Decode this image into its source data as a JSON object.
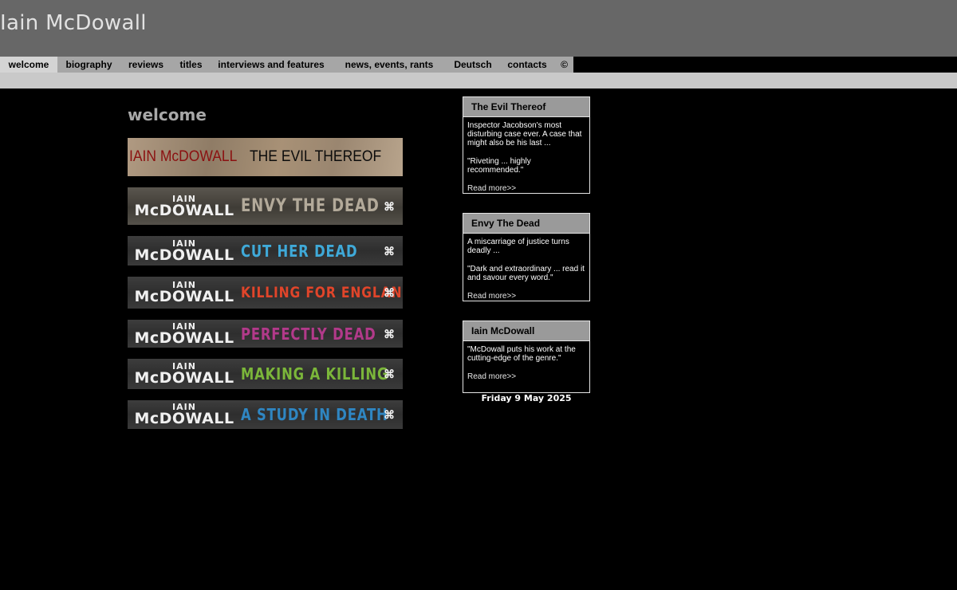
{
  "site": {
    "title": "Iain McDowall"
  },
  "nav": {
    "items": [
      {
        "label": "welcome",
        "active": true
      },
      {
        "label": "biography"
      },
      {
        "label": "reviews"
      },
      {
        "label": "titles"
      },
      {
        "label": "interviews and features"
      },
      {
        "label": "news, events, rants"
      },
      {
        "label": "Deutsch"
      },
      {
        "label": "contacts"
      },
      {
        "label": "©"
      }
    ]
  },
  "main": {
    "heading": "welcome",
    "banners": [
      {
        "author": "IAIN McDOWALL",
        "title": "THE EVIL THEREOF",
        "title_color": "#0c0c0c",
        "author_color": "#8b1010"
      },
      {
        "author_top": "IAIN",
        "author_bottom": "McDOWALL",
        "title": "ENVY THE DEAD",
        "title_color": "#b3aa9a"
      },
      {
        "author_top": "IAIN",
        "author_bottom": "McDOWALL",
        "title": "CUT HER DEAD",
        "title_color": "#3fa9d8"
      },
      {
        "author_top": "IAIN",
        "author_bottom": "McDOWALL",
        "title": "KILLING FOR ENGLAND",
        "title_color": "#e0452a"
      },
      {
        "author_top": "IAIN",
        "author_bottom": "McDOWALL",
        "title": "PERFECTLY DEAD",
        "title_color": "#b23a8a"
      },
      {
        "author_top": "IAIN",
        "author_bottom": "McDOWALL",
        "title": "MAKING A KILLING",
        "title_color": "#7bb63a"
      },
      {
        "author_top": "IAIN",
        "author_bottom": "McDOWALL",
        "title": "A STUDY IN DEATH",
        "title_color": "#2f86c2"
      }
    ]
  },
  "sidebar": {
    "boxes": [
      {
        "title": "The Evil Thereof",
        "paragraphs": [
          "Inspector Jacobson's most disturbing case ever. A case that might also be his last ...",
          "\"Riveting ... highly recommended.\""
        ],
        "link": "Read more>>"
      },
      {
        "title": "Envy The Dead",
        "paragraphs": [
          "A miscarriage of justice turns deadly ...",
          "\"Dark and extraordinary ... read it and savour every word.\""
        ],
        "link": "Read more>>"
      },
      {
        "title": "Iain McDowall",
        "paragraphs": [
          "\"McDowall puts his work at the cutting-edge of the genre.\""
        ],
        "link": "Read more>>"
      }
    ],
    "date": "Friday 9 May 2025"
  }
}
